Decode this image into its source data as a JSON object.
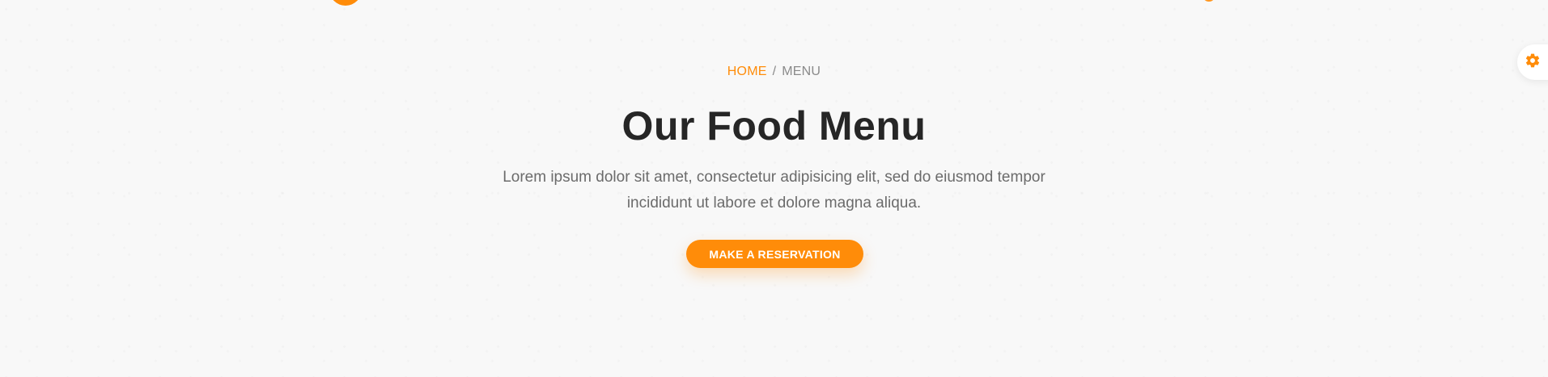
{
  "breadcrumb": {
    "home": "HOME",
    "separator": "/",
    "current": "MENU"
  },
  "hero": {
    "title": "Our Food Menu",
    "description": "Lorem ipsum dolor sit amet, consectetur adipisicing elit, sed do eiusmod tempor incididunt ut labore et dolore magna aliqua.",
    "cta_label": "MAKE A RESERVATION"
  },
  "icons": {
    "settings": "gear-icon"
  },
  "colors": {
    "accent": "#ff8c09",
    "title": "#262626",
    "body_text": "#6b6b6b",
    "muted": "#8a8a8a",
    "background": "#f8f8f8"
  }
}
